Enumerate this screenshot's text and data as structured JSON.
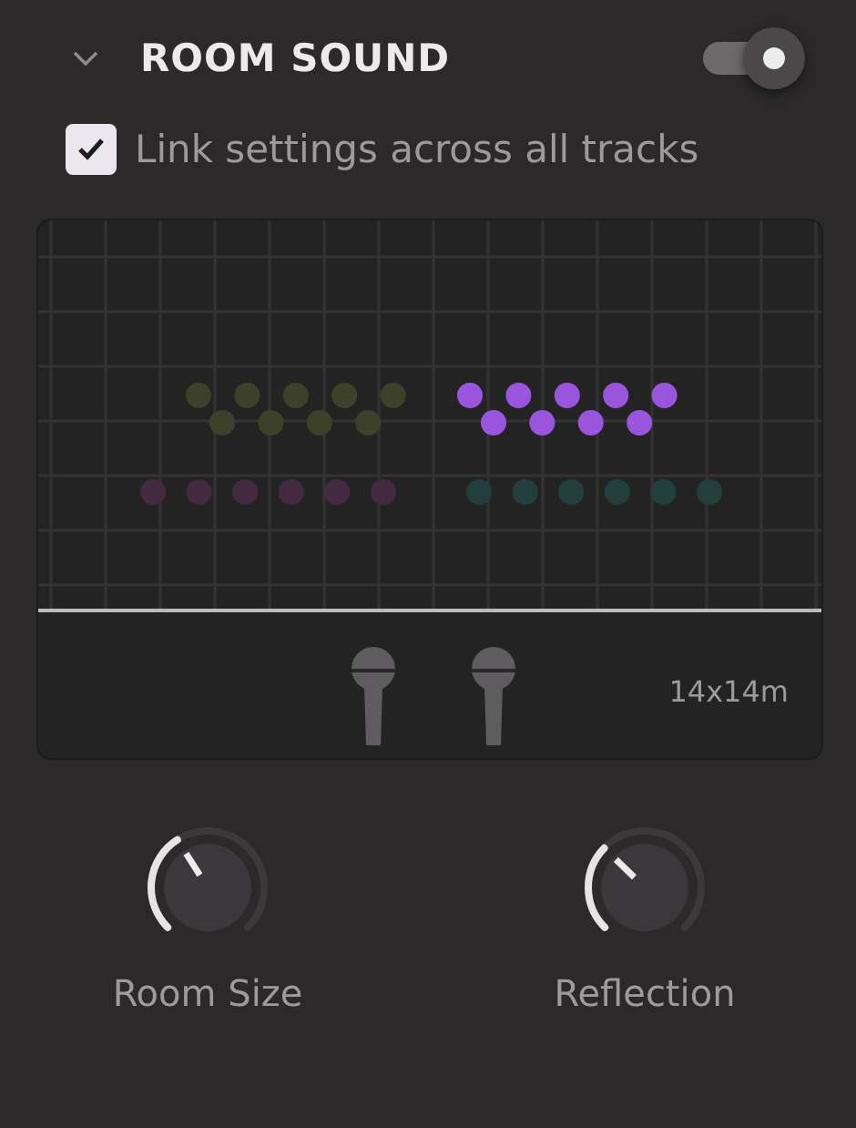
{
  "section": {
    "title": "ROOM SOUND",
    "expanded": true,
    "enabled": true
  },
  "link": {
    "label": "Link settings across all tracks",
    "checked": true
  },
  "room": {
    "size": "14x14m",
    "groups": [
      {
        "kind": "zigzag",
        "color": "#3d4129"
      },
      {
        "kind": "zigzag",
        "color": "#9a55dd"
      },
      {
        "kind": "row",
        "color": "#432a40"
      },
      {
        "kind": "row",
        "color": "#233f3d"
      }
    ]
  },
  "knobs": [
    {
      "label": "Room Size"
    },
    {
      "label": "Reflection"
    }
  ]
}
